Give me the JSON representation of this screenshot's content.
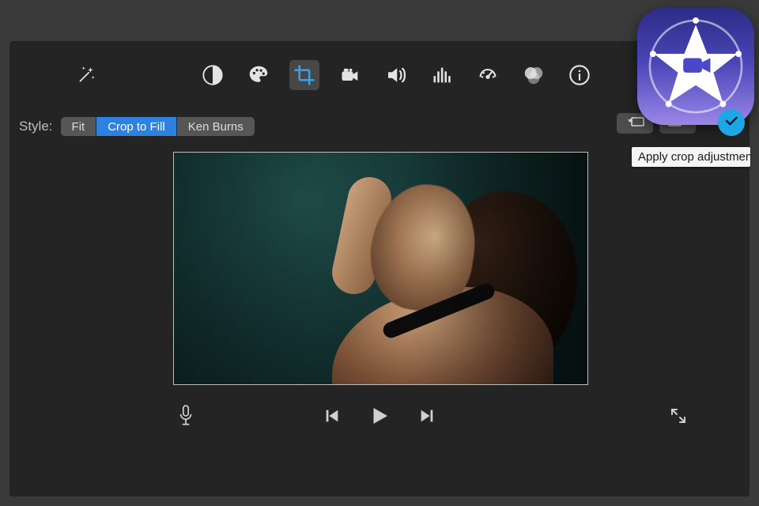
{
  "toolbar": {
    "icons": {
      "auto_enhance": "auto-enhance-wand-icon",
      "color_balance": "color-balance-icon",
      "color_correction": "color-palette-icon",
      "crop": "crop-icon",
      "stabilization": "camera-icon",
      "volume": "volume-icon",
      "noise_eq": "equalizer-icon",
      "speed": "speedometer-icon",
      "filters": "overlap-circles-icon",
      "info": "info-icon"
    }
  },
  "style_row": {
    "label": "Style:",
    "options": [
      "Fit",
      "Crop to Fill",
      "Ken Burns"
    ],
    "selected_index": 1,
    "rotate_ccw_icon": "rotate-ccw-icon",
    "rotate_cw_icon": "rotate-cw-icon"
  },
  "apply_button": {
    "tooltip": "Apply crop adjustments"
  },
  "transport": {
    "record_voiceover_icon": "microphone-icon",
    "prev_icon": "previous-frame-icon",
    "play_icon": "play-icon",
    "next_icon": "next-frame-icon",
    "fullscreen_icon": "expand-icon"
  },
  "app_badge": {
    "name": "imovie-app-icon"
  }
}
